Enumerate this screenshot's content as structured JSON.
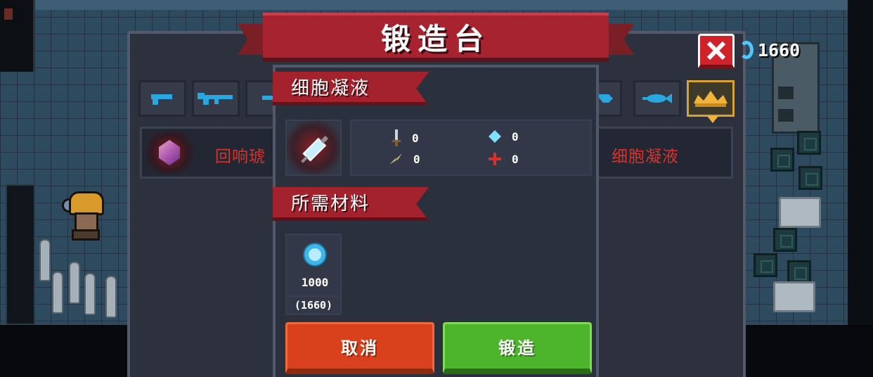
{
  "window": {
    "title": "锻造台"
  },
  "header": {
    "coins": "1660"
  },
  "item_list": {
    "left_item_name": "回响琥",
    "right_item_name": "细胞凝液"
  },
  "detail": {
    "item_name": "细胞凝液",
    "stats": {
      "damage": "0",
      "mana": "0",
      "crit": "0",
      "accuracy": "0"
    },
    "materials_header": "所需材料",
    "material": {
      "required": "1000",
      "owned": "(1660)"
    },
    "cancel_label": "取消",
    "forge_label": "锻造"
  },
  "colors": {
    "banner_red": "#a7232f",
    "accent_blue": "#4ec7ff",
    "cancel_orange": "#d8411b",
    "forge_green": "#4cb52b",
    "list_text_red": "#d8322d"
  },
  "icons": [
    "close-icon",
    "coin-icon",
    "weapon-tab-icons",
    "gem-icon",
    "syringe-icon",
    "sword-icon",
    "diamond-icon",
    "bolt-icon",
    "crosshair-icon",
    "blue-gem-coin-icon",
    "crown-icon"
  ]
}
